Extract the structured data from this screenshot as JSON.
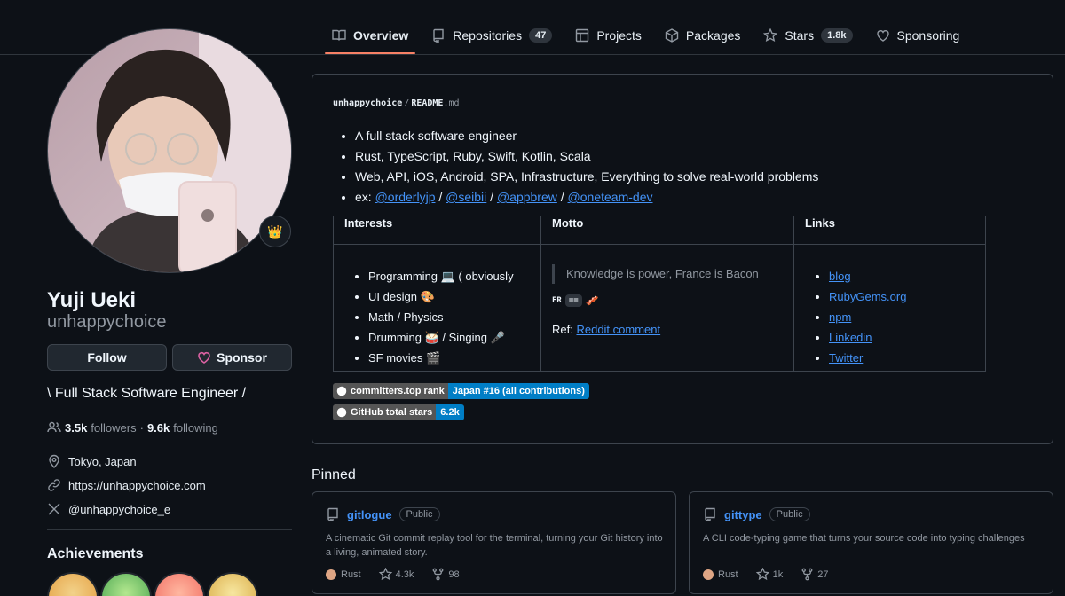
{
  "nav": {
    "tabs": [
      {
        "label": "Overview",
        "icon": "book-icon"
      },
      {
        "label": "Repositories",
        "count": "47",
        "icon": "repo-icon"
      },
      {
        "label": "Projects",
        "icon": "table-icon"
      },
      {
        "label": "Packages",
        "icon": "package-icon"
      },
      {
        "label": "Stars",
        "count": "1.8k",
        "icon": "star-icon"
      },
      {
        "label": "Sponsoring",
        "icon": "heart-icon"
      }
    ]
  },
  "profile": {
    "name": "Yuji Ueki",
    "login": "unhappychoice",
    "status_emoji": "👑",
    "follow_label": "Follow",
    "sponsor_label": "Sponsor",
    "bio": "\\ Full Stack Software Engineer /",
    "followers_count": "3.5k",
    "followers_label": "followers",
    "separator": "·",
    "following_count": "9.6k",
    "following_label": "following",
    "location": "Tokyo, Japan",
    "website": "https://unhappychoice.com",
    "twitter": "@unhappychoice_e",
    "achievements_title": "Achievements"
  },
  "readme": {
    "owner": "unhappychoice",
    "slash": "/",
    "file": "README",
    "ext": ".md",
    "bullets": [
      "A full stack software engineer",
      "Rust, TypeScript, Ruby, Swift, Kotlin, Scala",
      "Web, API, iOS, Android, SPA, Infrastructure, Everything to solve real-world problems"
    ],
    "ex_label": "ex: ",
    "ex_links": [
      "@orderlyjp",
      "@seibii",
      "@appbrew",
      "@oneteam-dev"
    ],
    "ex_sep": " / ",
    "table": {
      "headers": [
        "Interests",
        "Motto",
        "Links"
      ],
      "interests": [
        "Programming 💻  ( obviously",
        "UI design 🎨",
        "Math / Physics",
        "Drumming 🥁  / Singing 🎤",
        "SF movies 🎬"
      ],
      "motto_quote": "Knowledge is power, France is Bacon",
      "motto_fr": "FR",
      "motto_eq": "==",
      "motto_emoji": "🥓",
      "ref_label": "Ref: ",
      "ref_link": "Reddit comment",
      "links": [
        "blog",
        "RubyGems.org",
        "npm",
        "Linkedin",
        "Twitter"
      ]
    },
    "shields": [
      {
        "label": "committers.top rank",
        "value": "Japan #16 (all contributions)"
      },
      {
        "label": "GitHub total stars",
        "value": "6.2k"
      }
    ]
  },
  "pinned": {
    "title": "Pinned",
    "repos": [
      {
        "name": "gitlogue",
        "visibility": "Public",
        "description": "A cinematic Git commit replay tool for the terminal, turning your Git history into a living, animated story.",
        "language": "Rust",
        "language_color": "#dea584",
        "stars": "4.3k",
        "forks": "98"
      },
      {
        "name": "gittype",
        "visibility": "Public",
        "description": "A CLI code-typing game that turns your source code into typing challenges",
        "language": "Rust",
        "language_color": "#dea584",
        "stars": "1k",
        "forks": "27"
      }
    ]
  }
}
